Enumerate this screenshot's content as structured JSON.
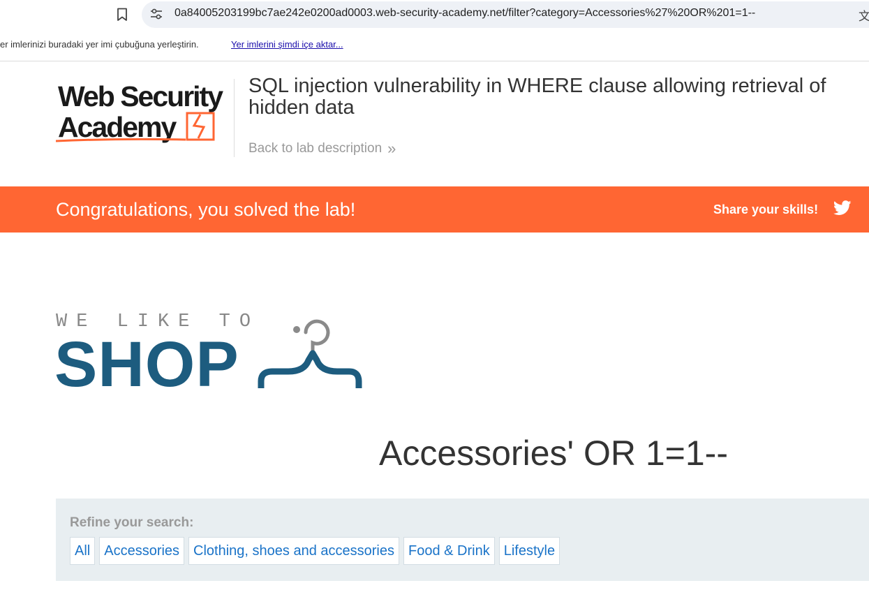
{
  "browser": {
    "url": "0a84005203199bc7ae242e0200ad0003.web-security-academy.net/filter?category=Accessories%27%20OR%201=1--",
    "translate_glyph": "文"
  },
  "bookmarks_bar": {
    "text": "er imlerinizi buradaki yer imi çubuğuna yerleştirin.",
    "link": "Yer imlerini şimdi içe aktar..."
  },
  "header": {
    "logo_line1": "Web Security",
    "logo_line2": "Academy",
    "lab_title": "SQL injection vulnerability in WHERE clause allowing retrieval of hidden data",
    "back_link": "Back to lab description",
    "back_chevron": "»"
  },
  "banner": {
    "solved_text": "Congratulations, you solved the lab!",
    "share_text": "Share your skills!",
    "color": "#ff6633"
  },
  "shop_logo": {
    "tagline": "WE LIKE TO",
    "word": "SHOP",
    "color": "#1d5c7f"
  },
  "category_heading": "Accessories' OR 1=1--",
  "filter": {
    "label": "Refine your search:",
    "options": [
      {
        "label": "All"
      },
      {
        "label": "Accessories"
      },
      {
        "label": "Clothing, shoes and accessories"
      },
      {
        "label": "Food & Drink"
      },
      {
        "label": "Lifestyle"
      }
    ]
  }
}
